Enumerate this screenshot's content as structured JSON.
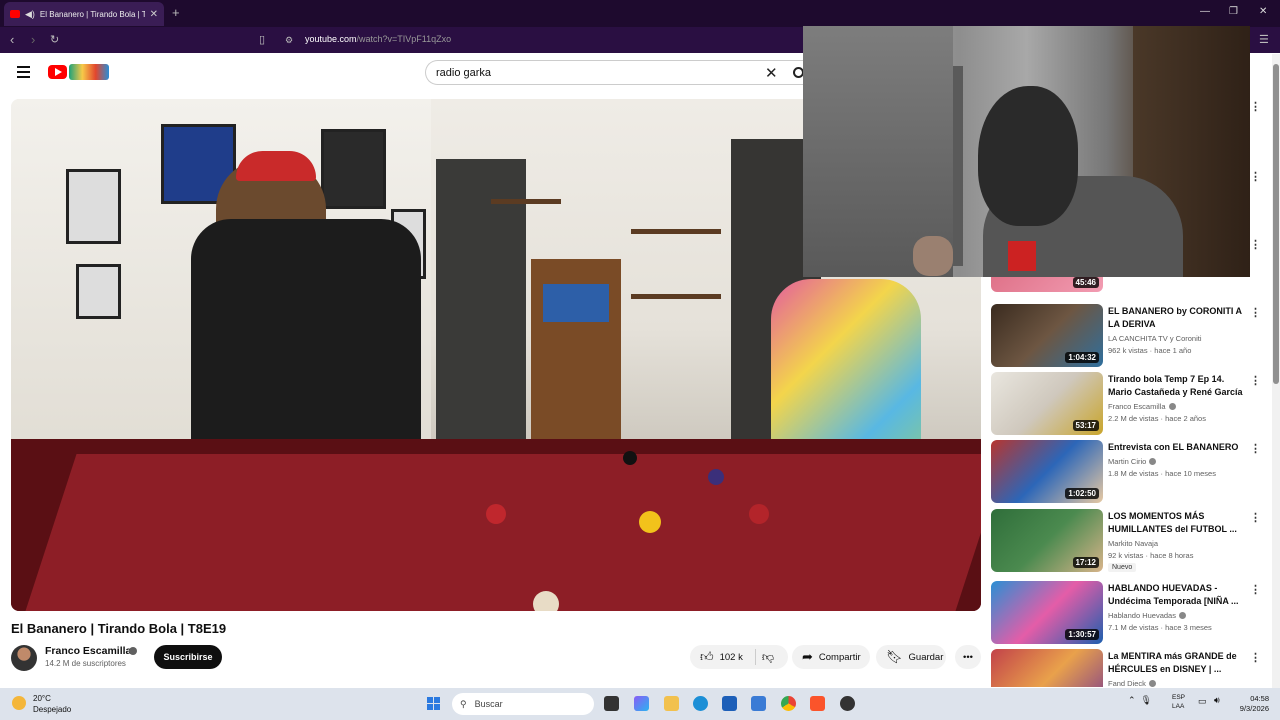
{
  "browser": {
    "tab_title": "El Bananero | Tirando Bola | T",
    "url_domain": "youtube.com",
    "url_path": "/watch?v=TIVpF11qZxo"
  },
  "youtube": {
    "search_value": "radio garka",
    "video_title": "El Bananero | Tirando Bola | T8E19",
    "channel_name": "Franco Escamilla",
    "subscribers": "14.2 M de suscriptores",
    "subscribe_label": "Suscribirse",
    "likes": "102 k",
    "share_label": "Compartir",
    "save_label": "Guardar"
  },
  "sidebar": {
    "items": [
      {
        "duration": "45:46"
      },
      {
        "title": "EL BANANERO by CORONITI A LA DERIVA",
        "channel": "LA CANCHITA TV y Coroniti",
        "meta": "962 k vistas · hace 1 año",
        "duration": "1:04:32"
      },
      {
        "title": "Tirando bola Temp 7 Ep 14. Mario Castañeda y René García",
        "channel": "Franco Escamilla",
        "meta": "2.2 M de vistas · hace 2 años",
        "duration": "53:17"
      },
      {
        "title": "Entrevista con EL BANANERO",
        "channel": "Martin Cirio",
        "meta": "1.8 M de vistas · hace 10 meses",
        "duration": "1:02:50"
      },
      {
        "title": "LOS MOMENTOS MÁS HUMILLANTES del FUTBOL ...",
        "channel": "Markito Navaja",
        "meta": "92 k vistas · hace 8 horas",
        "badge": "Nuevo",
        "duration": "17:12"
      },
      {
        "title": "HABLANDO HUEVADAS - Undécima Temporada [NIÑA ...",
        "channel": "Hablando Huevadas",
        "meta": "7.1 M de vistas · hace 3 meses",
        "duration": "1:30:57"
      },
      {
        "title": "La MENTIRA más GRANDE de HÉRCULES en DISNEY | ...",
        "channel": "Fand Dieck",
        "meta": ""
      }
    ]
  },
  "taskbar": {
    "temperature": "20°C",
    "condition": "Despejado",
    "search_placeholder": "Buscar",
    "lang_top": "ESP",
    "lang_bottom": "LAA",
    "time": "04:58",
    "date": "9/3/2026"
  },
  "colors": {
    "youtube_red": "#ff0000",
    "browser_bg": "#1e0a2e"
  }
}
